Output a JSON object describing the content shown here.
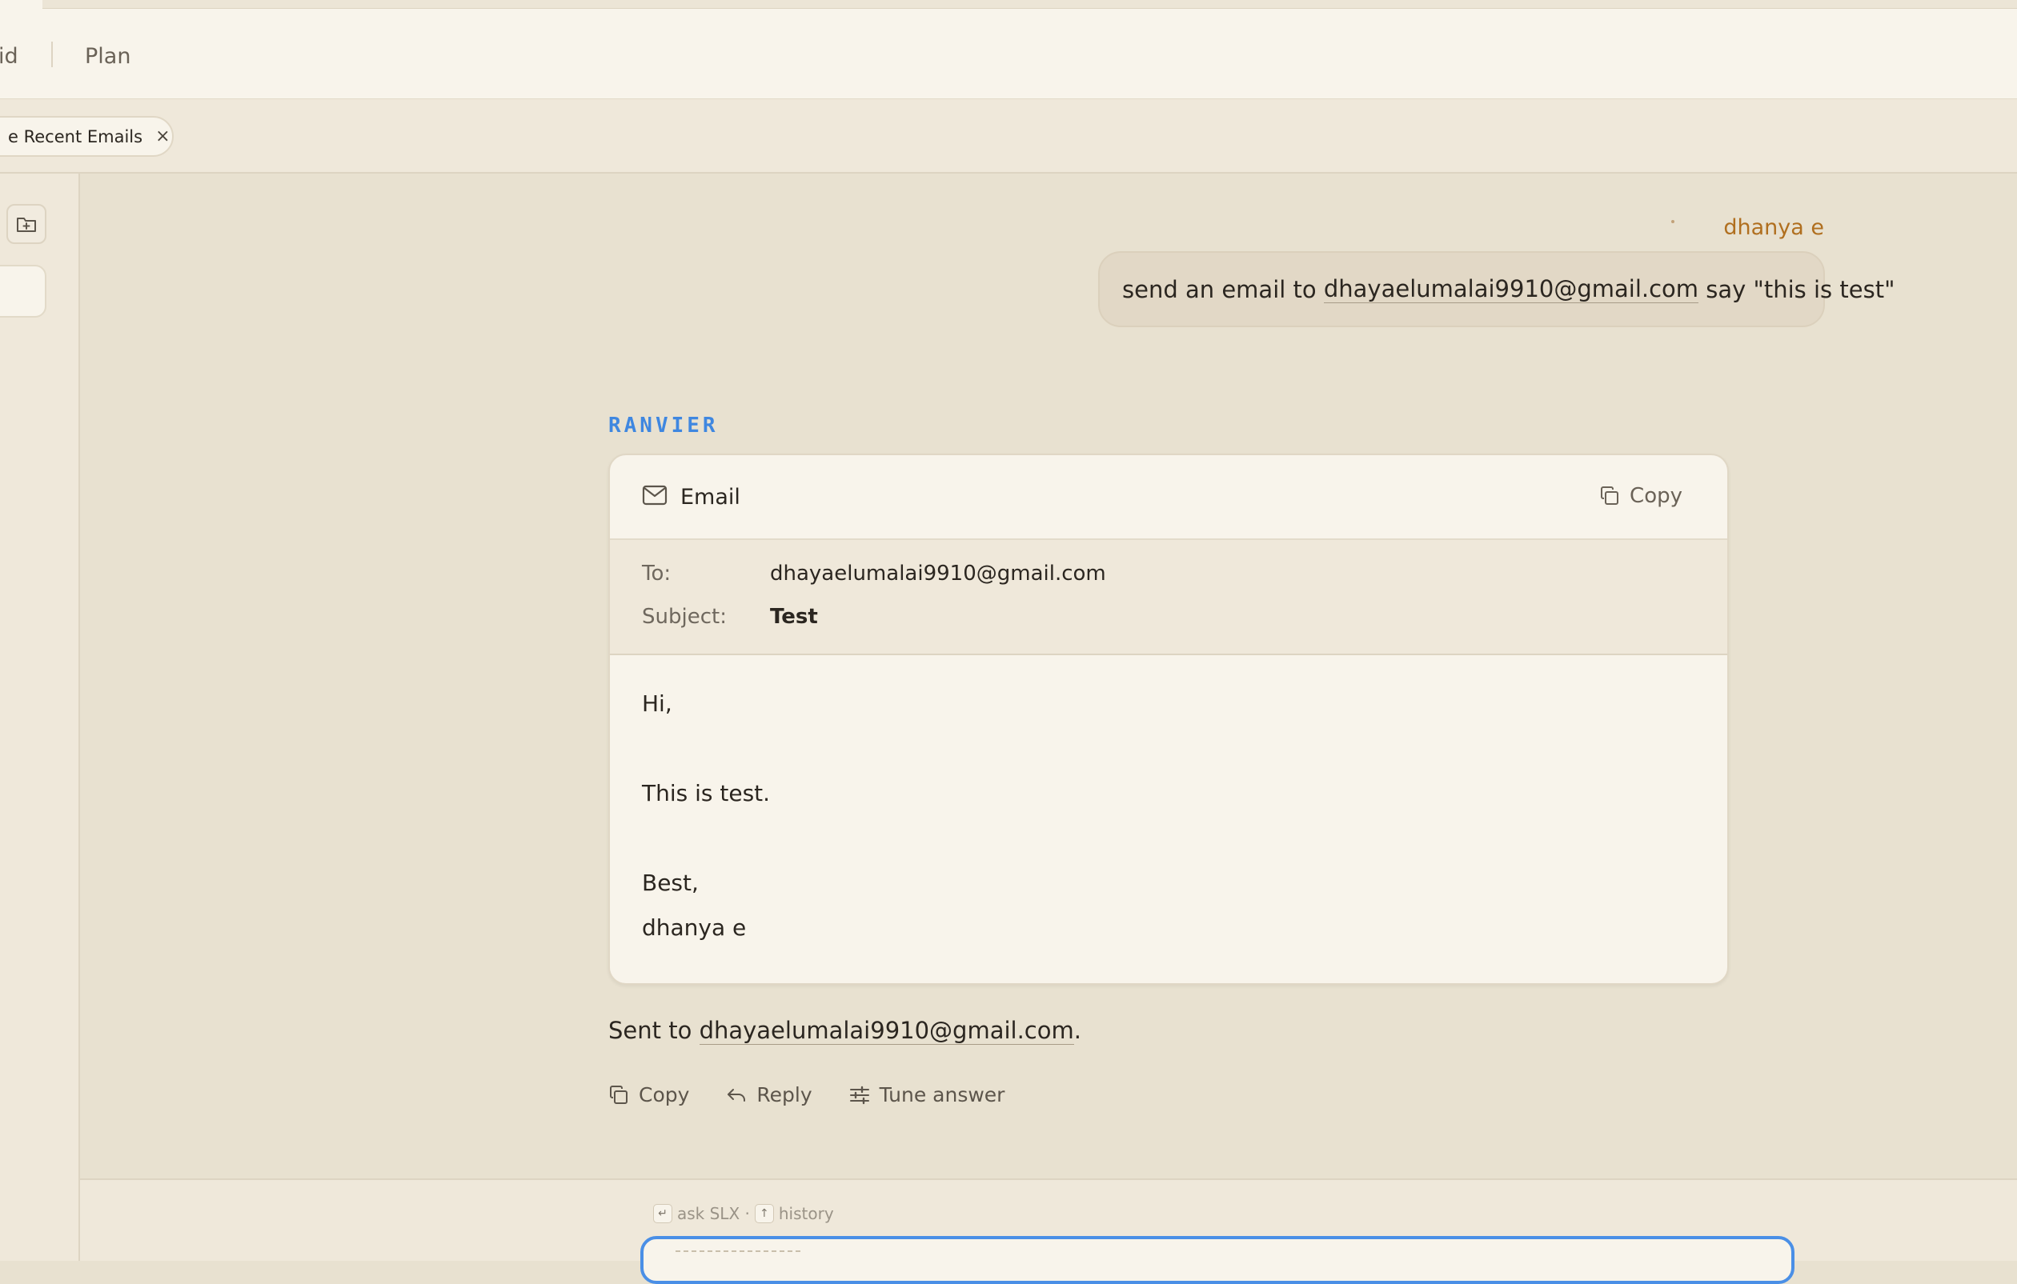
{
  "nav": {
    "item_partial": "id",
    "item_plan": "Plan"
  },
  "tabs": {
    "active_chip_label": "e Recent Emails",
    "close_symbol": "×"
  },
  "chat": {
    "user": {
      "name": "dhanya e",
      "message_prefix": "send an email to ",
      "message_email": "dhayaelumalai9910@gmail.com",
      "message_suffix": " say \"this is test\""
    },
    "assistant": {
      "label": "RANVIER",
      "email_card": {
        "title": "Email",
        "copy_label": "Copy",
        "to_label": "To:",
        "to_value": "dhayaelumalai9910@gmail.com",
        "subject_label": "Subject:",
        "subject_value": "Test",
        "body_lines": [
          "Hi,",
          "This is test.",
          "Best,",
          "dhanya e"
        ]
      },
      "sent_prefix": "Sent to ",
      "sent_email": "dhayaelumalai9910@gmail.com",
      "sent_suffix": ".",
      "actions": {
        "copy": "Copy",
        "reply": "Reply",
        "tune": "Tune answer"
      }
    }
  },
  "composer": {
    "enter_key": "↵",
    "ask_label": "ask SLX ·",
    "up_key": "↑",
    "history_label": "history"
  },
  "colors": {
    "accent_blue": "#3f87e0",
    "user_name": "#b06f1f",
    "background": "#e8e1d0",
    "surface": "#f8f4eb"
  },
  "icons": [
    "folder-plus-icon",
    "mail-icon",
    "copy-icon",
    "reply-icon",
    "sliders-icon",
    "close-icon"
  ]
}
